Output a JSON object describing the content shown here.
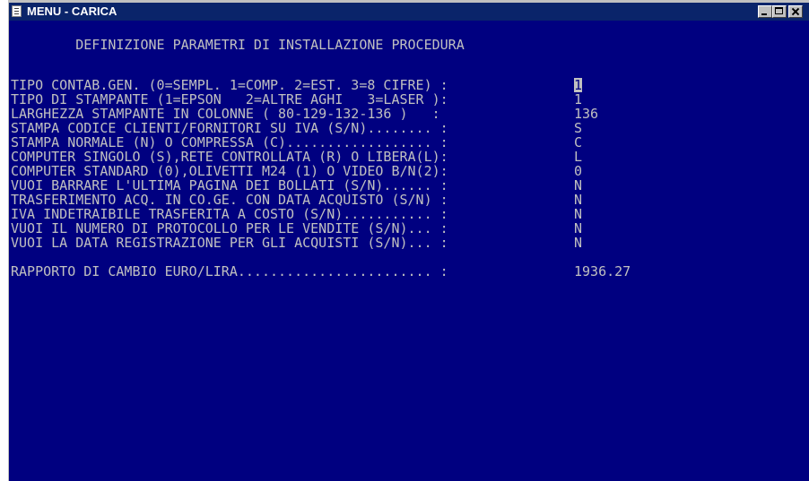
{
  "window": {
    "title": "MENU - CARICA"
  },
  "console": {
    "heading": "        DEFINIZIONE PARAMETRI DI INSTALLAZIONE PROCEDURA",
    "params": [
      {
        "label": "TIPO CONTAB.GEN. (0=SEMPL. 1=COMP. 2=EST. 3=8 CIFRE) :",
        "value": "1"
      },
      {
        "label": "TIPO DI STAMPANTE (1=EPSON   2=ALTRE AGHI   3=LASER ):",
        "value": "1"
      },
      {
        "label": "LARGHEZZA STAMPANTE IN COLONNE ( 80-129-132-136 )   :",
        "value": "136"
      },
      {
        "label": "STAMPA CODICE CLIENTI/FORNITORI SU IVA (S/N)........ :",
        "value": "S"
      },
      {
        "label": "STAMPA NORMALE (N) O COMPRESSA (C).................. :",
        "value": "C"
      },
      {
        "label": "COMPUTER SINGOLO (S),RETE CONTROLLATA (R) O LIBERA(L):",
        "value": "L"
      },
      {
        "label": "COMPUTER STANDARD (0),OLIVETTI M24 (1) O VIDEO B/N(2):",
        "value": "0"
      },
      {
        "label": "VUOI BARRARE L'ULTIMA PAGINA DEI BOLLATI (S/N)...... :",
        "value": "N"
      },
      {
        "label": "TRASFERIMENTO ACQ. IN CO.GE. CON DATA ACQUISTO (S/N) :",
        "value": "N"
      },
      {
        "label": "IVA INDETRAIBILE TRASFERITA A COSTO (S/N)........... :",
        "value": "N"
      },
      {
        "label": "VUOI IL NUMERO DI PROTOCOLLO PER LE VENDITE (S/N)... :",
        "value": "N"
      },
      {
        "label": "VUOI LA DATA REGISTRAZIONE PER GLI ACQUISTI (S/N)... :",
        "value": "N"
      }
    ],
    "exchange": {
      "label": "RAPPORTO DI CAMBIO EURO/LIRA........................ :",
      "value": "1936.27"
    }
  }
}
